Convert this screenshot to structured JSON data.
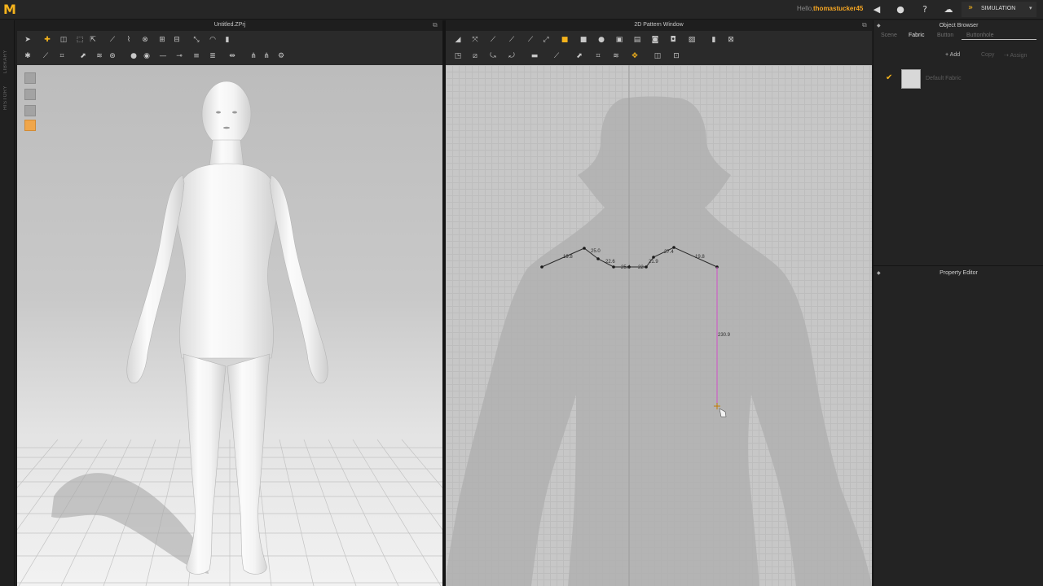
{
  "app": {
    "logo": "M",
    "greeting": "Hello,",
    "username": "thomastucker45",
    "mode": "SIMULATION",
    "icons": [
      "speaker-icon",
      "user-icon",
      "help-icon",
      "cloud-icon",
      "simulation-icon"
    ]
  },
  "sidebar": {
    "library_label": "LIBRARY",
    "history_label": "HISTORY"
  },
  "window3d": {
    "title": "Untitled.ZPrj"
  },
  "window2d": {
    "title": "2D Pattern Window",
    "measurements": [
      "25.0",
      "19.8",
      "22.6",
      "25.4",
      "22",
      "27.4",
      "19.8",
      "21.9",
      "230.9"
    ]
  },
  "object_browser": {
    "title": "Object Browser",
    "tabs": [
      "Scene",
      "Fabric",
      "Button",
      "Buttonhole"
    ],
    "active_tab": "Fabric",
    "add_label": "Add",
    "copy_label": "Copy",
    "assign_label": "Assign",
    "fabric_name": "Default Fabric"
  },
  "property_editor": {
    "title": "Property Editor"
  },
  "colors": {
    "accent": "#f5b31c",
    "username": "#f5a623",
    "new_line": "#d050c8"
  }
}
